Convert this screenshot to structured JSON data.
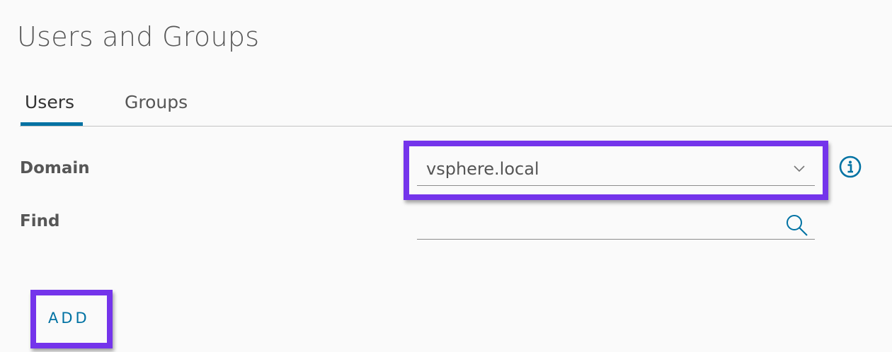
{
  "page": {
    "title": "Users and Groups"
  },
  "tabs": [
    {
      "label": "Users",
      "active": true
    },
    {
      "label": "Groups",
      "active": false
    }
  ],
  "form": {
    "domain_label": "Domain",
    "domain_value": "vsphere.local",
    "find_label": "Find",
    "find_value": "",
    "find_placeholder": ""
  },
  "actions": {
    "add_label": "ADD"
  },
  "icons": {
    "domain_dropdown": "chevron-down-icon",
    "domain_info": "info-icon",
    "find": "search-icon"
  },
  "colors": {
    "accent": "#0072a3",
    "highlight": "#7434eb",
    "text": "#565656",
    "background": "#fafafa"
  }
}
